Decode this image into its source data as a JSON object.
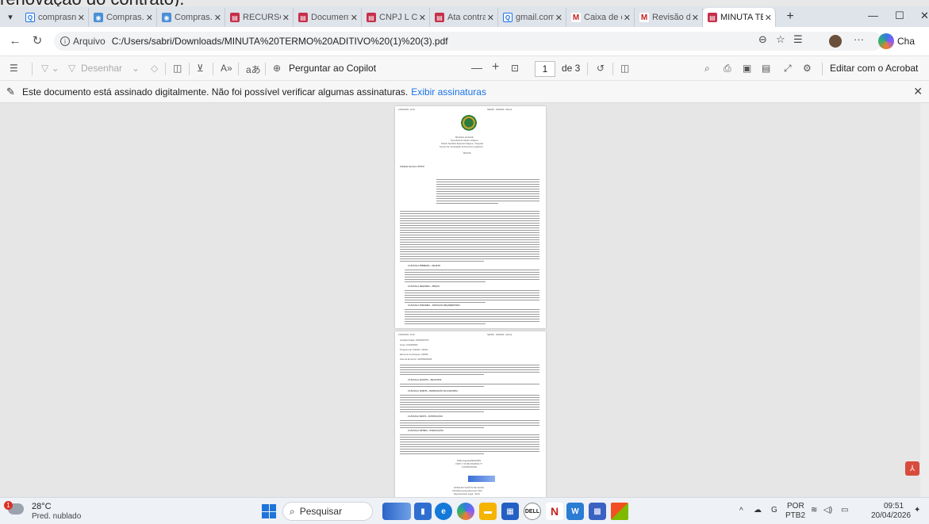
{
  "peek_text": "renovação do contrato).",
  "tabs": [
    {
      "label": "comprasne",
      "icon": "search-icon"
    },
    {
      "label": "Compras.g",
      "icon": "compras-icon"
    },
    {
      "label": "Compras.g",
      "icon": "compras-icon"
    },
    {
      "label": "RECURSO (",
      "icon": "pdf-icon"
    },
    {
      "label": "Documenta",
      "icon": "pdf-icon"
    },
    {
      "label": "CNPJ L C E",
      "icon": "pdf-icon"
    },
    {
      "label": "Ata contrat",
      "icon": "pdf-icon"
    },
    {
      "label": "gmail.com",
      "icon": "search-icon"
    },
    {
      "label": "Caixa de en",
      "icon": "gmail-icon"
    },
    {
      "label": "Revisão de",
      "icon": "gmail-icon"
    },
    {
      "label": "MINUTA TE",
      "icon": "pdf-icon",
      "active": true
    }
  ],
  "address": {
    "label": "Arquivo",
    "url": "C:/Users/sabri/Downloads/MINUTA%20TERMO%20ADITIVO%20(1)%20(3).pdf",
    "copilot_label": "Cha"
  },
  "pdf_toolbar": {
    "draw_label": "Desenhar",
    "copilot_label": "Perguntar ao Copilot",
    "page_current": "1",
    "page_total": "de 3",
    "edit_label": "Editar com o Acrobat"
  },
  "signature_notice": {
    "text": "Este documento está assinado digitalmente. Não foi possível verificar algumas assinaturas.",
    "link": "Exibir assinaturas"
  },
  "pdf_page1": {
    "header_left": "21/05/2025, 11:45",
    "header_right": "SEI/MS - 0000000 - Minuta",
    "org_lines": [
      "Ministério da Saúde",
      "Secretaria de Saúde Indígena",
      "Distrito Sanitário Especial Indígena - Araguaia",
      "Serviço de Contratação de Recursos Logísticos"
    ],
    "doc_title": "MINUTA",
    "process_ref": "Unidade Gestora: 257047",
    "section_headings": [
      "CLÁUSULA PRIMEIRA – OBJETO",
      "CLÁUSULA SEGUNDA – PREÇO",
      "CLÁUSULA TERCEIRA – DOTAÇÃO ORÇAMENTÁRIA"
    ]
  },
  "pdf_page2": {
    "header_left": "21/05/2025, 11:45",
    "header_right": "SEI/MS - 0000000 - Minuta",
    "intro_lines": [
      "Gestão/Unidade: 36000/257047",
      "Fonte: 1002000000",
      "Programa de Trabalho: 163411",
      "Elemento de Despesa: 339039",
      "Nota de Empenho: 2025NE000000"
    ],
    "section_headings": [
      "CLÁUSULA QUARTA – REAJUSTE",
      "CLÁUSULA QUINTA – RENOVAÇÃO DA GARANTIA",
      "CLÁUSULA SEXTA – RATIFICAÇÃO",
      "CLÁUSULA SÉTIMA – PUBLICAÇÃO"
    ],
    "signature_lines": [
      "DSEI Araguaia/SESAI/MS",
      "CNPJ nº 00.394.544/0001-77",
      "CONTRATANTE"
    ],
    "contractor_lines": [
      "RONALDO SANTOS DE SOUZA",
      "AKCSE Empreendimentos LTDA",
      "Representante Legal - Sócio"
    ]
  },
  "taskbar": {
    "weather_badge": "1",
    "temp": "28°C",
    "weather_desc": "Pred. nublado",
    "search_placeholder": "Pesquisar",
    "lang_top": "POR",
    "lang_bottom": "PTB2",
    "time": "09:51",
    "date": "20/04/2026"
  },
  "colors": {
    "accent": "#1a73e8",
    "pdf_tab": "#c4314b",
    "adobe": "#d94b3c"
  }
}
